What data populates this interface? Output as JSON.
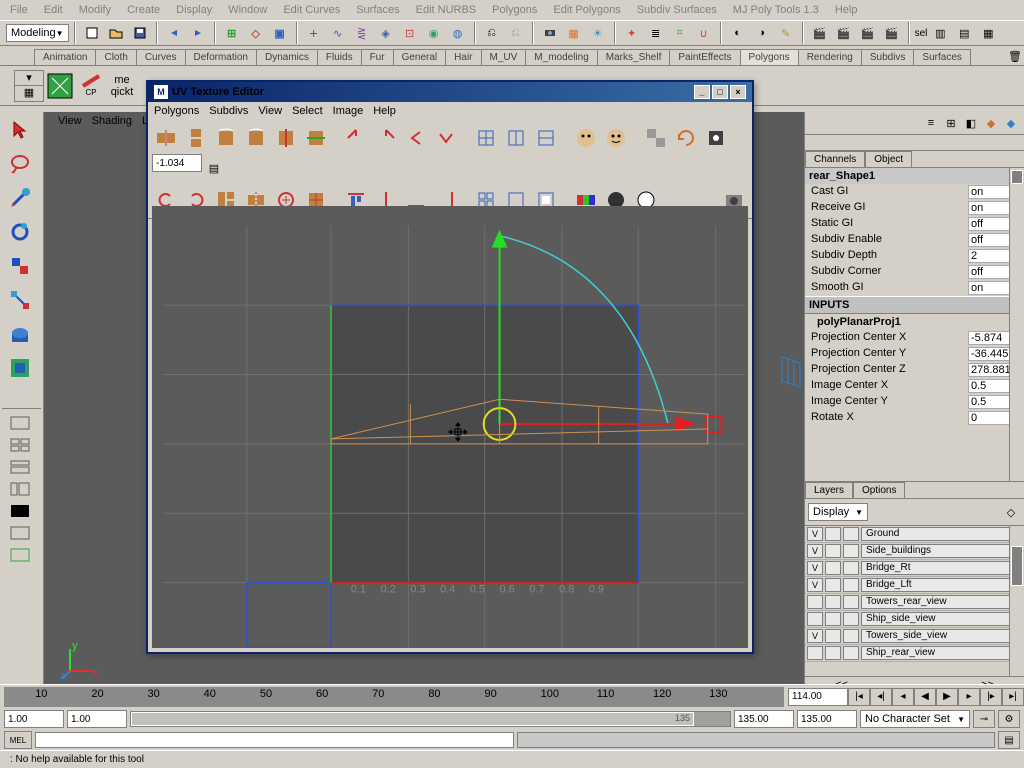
{
  "menu": {
    "items": [
      "File",
      "Edit",
      "Modify",
      "Create",
      "Display",
      "Window",
      "Edit Curves",
      "Surfaces",
      "Edit NURBS",
      "Polygons",
      "Edit Polygons",
      "Subdiv Surfaces",
      "MJ Poly Tools 1.3",
      "Help"
    ]
  },
  "mode_dropdown": "Modeling",
  "shelf_tabs": [
    "Animation",
    "Cloth",
    "Curves",
    "Deformation",
    "Dynamics",
    "Fluids",
    "Fur",
    "General",
    "Hair",
    "M_UV",
    "M_modeling",
    "Marks_Shelf",
    "PaintEffects",
    "Polygons",
    "Rendering",
    "Subdivs",
    "Surfaces"
  ],
  "active_shelf": "Polygons",
  "shelf_labels": {
    "cp": "CP",
    "me": "me",
    "qick": "qickt"
  },
  "view_tabs": [
    "View",
    "Shading",
    "Lig"
  ],
  "uv_editor": {
    "title": "UV Texture Editor",
    "menu": [
      "Polygons",
      "Subdivs",
      "View",
      "Select",
      "Image",
      "Help"
    ],
    "field_value": "-1.034"
  },
  "channels": {
    "tabs": [
      "Channels",
      "Object"
    ],
    "node": "rear_Shape1",
    "attrs": [
      {
        "k": "Cast GI",
        "v": "on"
      },
      {
        "k": "Receive GI",
        "v": "on"
      },
      {
        "k": "Static GI",
        "v": "off"
      },
      {
        "k": "Subdiv Enable",
        "v": "off"
      },
      {
        "k": "Subdiv Depth",
        "v": "2"
      },
      {
        "k": "Subdiv Corner",
        "v": "off"
      },
      {
        "k": "Smooth GI",
        "v": "on"
      }
    ],
    "inputs_head": "INPUTS",
    "input_node": "polyPlanarProj1",
    "inputs": [
      {
        "k": "Projection Center X",
        "v": "-5.874"
      },
      {
        "k": "Projection Center Y",
        "v": "-36.445"
      },
      {
        "k": "Projection Center Z",
        "v": "278.881"
      },
      {
        "k": "Image Center X",
        "v": "0.5"
      },
      {
        "k": "Image Center Y",
        "v": "0.5"
      },
      {
        "k": "Rotate X",
        "v": "0"
      }
    ]
  },
  "layers": {
    "tabs": [
      "Layers",
      "Options"
    ],
    "display": "Display",
    "rows": [
      {
        "v": "V",
        "name": "Ground"
      },
      {
        "v": "V",
        "name": "Side_buildings"
      },
      {
        "v": "V",
        "name": "Bridge_Rt"
      },
      {
        "v": "V",
        "name": "Bridge_Lft"
      },
      {
        "v": "",
        "name": "Towers_rear_view"
      },
      {
        "v": "",
        "name": "Ship_side_view"
      },
      {
        "v": "V",
        "name": "Towers_side_view"
      },
      {
        "v": "",
        "name": "Ship_rear_view"
      }
    ]
  },
  "timeline": {
    "ticks": [
      "10",
      "20",
      "30",
      "40",
      "50",
      "60",
      "70",
      "80",
      "90",
      "100",
      "110",
      "120",
      "130"
    ],
    "current": "114.00",
    "range_start": "1.00",
    "range_start2": "1.00",
    "range_mid": "135",
    "range_end": "135.00",
    "range_end2": "135.00",
    "charset": "No Character Set"
  },
  "help_line": ": No help available for this tool",
  "sel_label": "sel"
}
